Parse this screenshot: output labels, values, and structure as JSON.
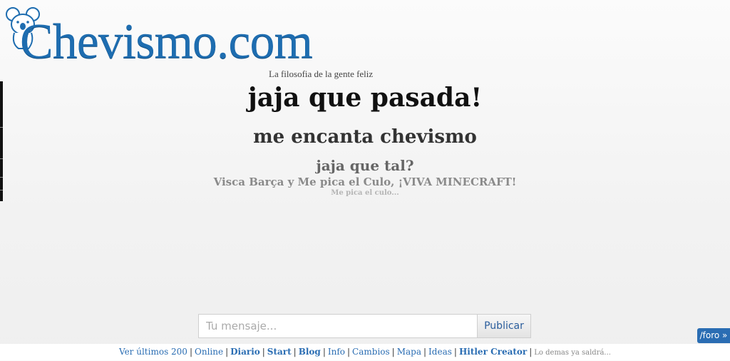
{
  "header": {
    "logo_text": "Chevismo.com",
    "tagline": "La filosofia de la gente feliz"
  },
  "messages": [
    "jaja que pasada!",
    "me encanta chevismo",
    "jaja que tal?",
    "Visca Barça y Me pica el Culo, ¡VIVA MINECRAFT!",
    "Me pica el culo..."
  ],
  "form": {
    "placeholder": "Tu mensaje...",
    "value": "",
    "submit_label": "Publicar"
  },
  "foro_tab": "/foro »",
  "footer": {
    "links": [
      {
        "label": "Ver últimos 200",
        "bold": false
      },
      {
        "label": "Online",
        "bold": false
      },
      {
        "label": "Diario",
        "bold": true
      },
      {
        "label": "Start",
        "bold": true
      },
      {
        "label": "Blog",
        "bold": true
      },
      {
        "label": "Info",
        "bold": false
      },
      {
        "label": "Cambios",
        "bold": false
      },
      {
        "label": "Mapa",
        "bold": false
      },
      {
        "label": "Ideas",
        "bold": false
      },
      {
        "label": "Hitler Creator",
        "bold": true
      }
    ],
    "rest_text": "Lo demas ya saldrá..."
  },
  "colors": {
    "brand": "#1e6db0",
    "link": "#2a6db3"
  }
}
